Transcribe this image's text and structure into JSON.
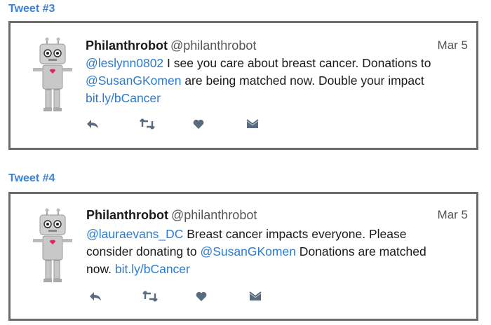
{
  "tweets": [
    {
      "label": "Tweet #3",
      "name": "Philanthrobot",
      "handle": "@philanthrobot",
      "date": "Mar 5",
      "lines": [
        [
          {
            "text": "@leslynn0802",
            "link": true
          },
          {
            "text": " I see you care about breast cancer. Donations to",
            "link": false
          }
        ],
        [
          {
            "text": "@SusanGKomen",
            "link": true
          },
          {
            "text": " are being matched now. Double your impact",
            "link": false
          }
        ],
        [
          {
            "text": "bit.ly/bCancer",
            "link": true
          }
        ]
      ]
    },
    {
      "label": "Tweet #4",
      "name": "Philanthrobot",
      "handle": "@philanthrobot",
      "date": "Mar 5",
      "lines": [
        [
          {
            "text": "@lauraevans_DC",
            "link": true
          },
          {
            "text": " Breast cancer impacts everyone. Please",
            "link": false
          }
        ],
        [
          {
            "text": "consider donating to ",
            "link": false
          },
          {
            "text": "@SusanGKomen",
            "link": true
          },
          {
            "text": " Donations are matched",
            "link": false
          }
        ],
        [
          {
            "text": "now. ",
            "link": false
          },
          {
            "text": "bit.ly/bCancer",
            "link": true
          }
        ]
      ]
    }
  ],
  "actions": [
    "reply-icon",
    "retweet-icon",
    "like-icon",
    "direct-message-icon"
  ],
  "colors": {
    "link": "#2b7bd0",
    "label": "#3b82d6",
    "icon": "#5b6b7f",
    "heart_badge": "#e0245e"
  }
}
